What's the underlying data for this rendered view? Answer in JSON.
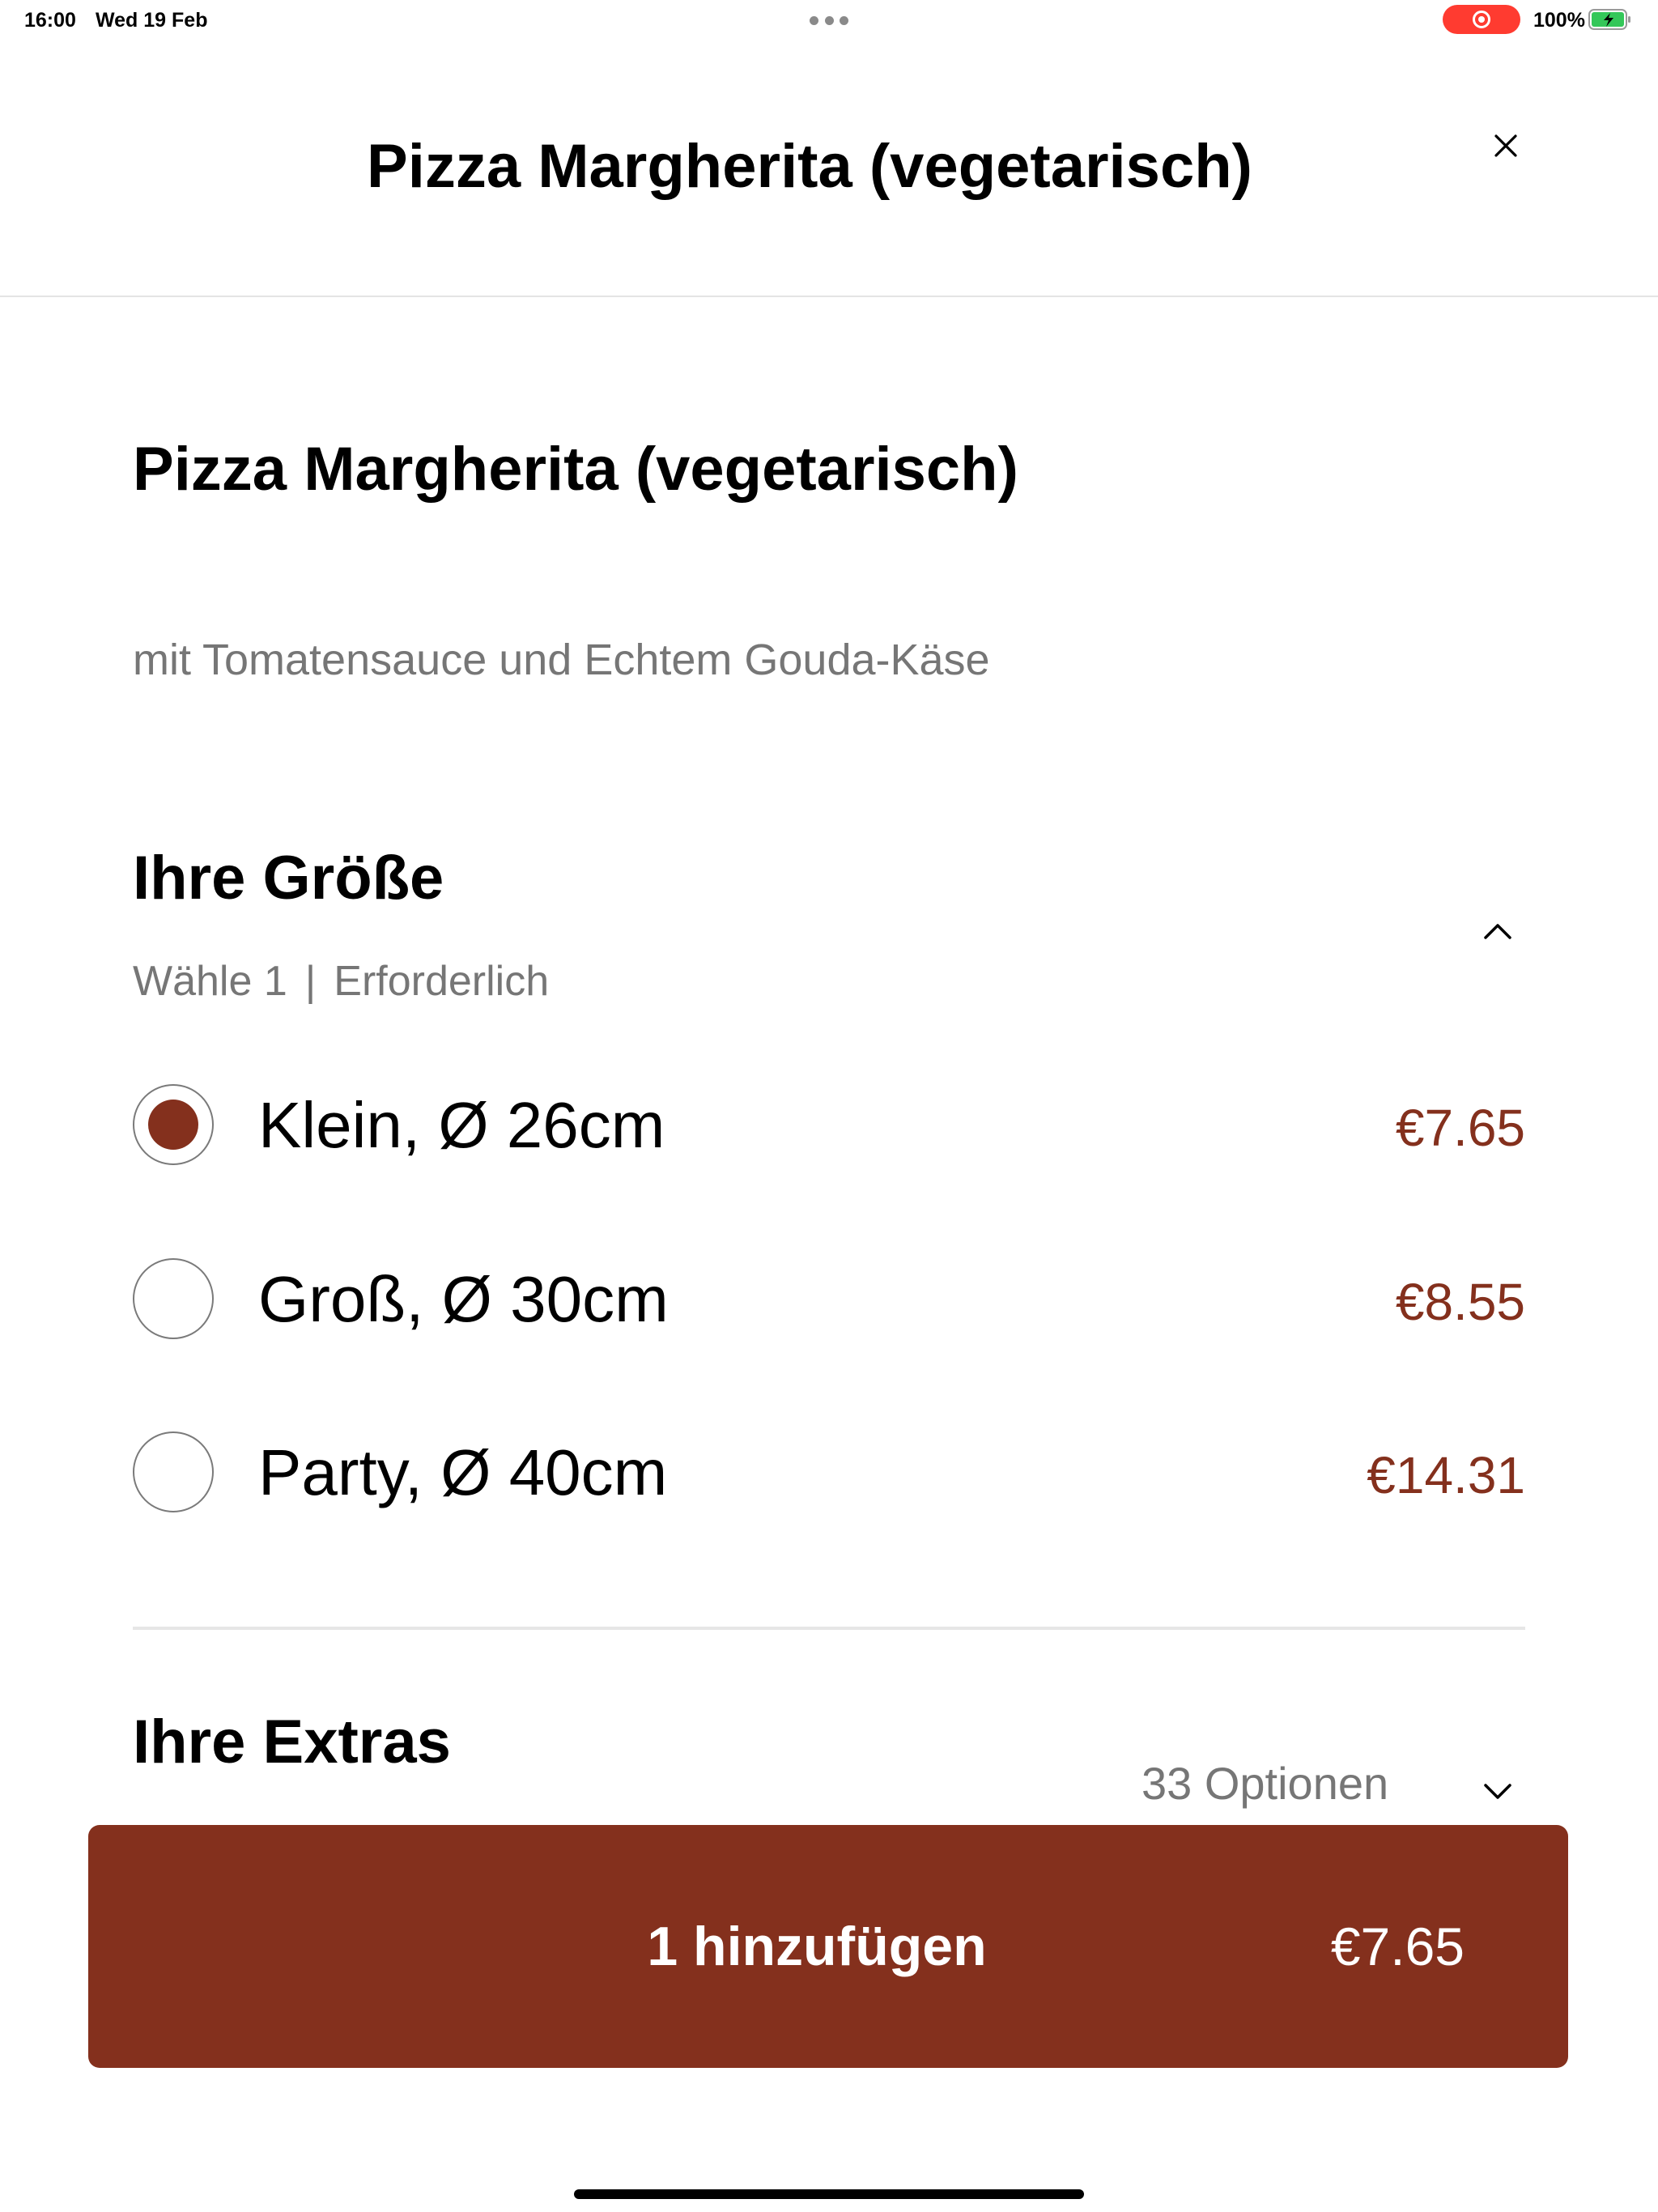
{
  "status_bar": {
    "time": "16:00",
    "date": "Wed 19 Feb",
    "battery": "100%"
  },
  "header": {
    "title": "Pizza Margherita (vegetarisch)",
    "close_icon": "close-icon"
  },
  "item": {
    "title": "Pizza Margherita (vegetarisch)",
    "description": "mit Tomatensauce und Echtem Gouda-Käse"
  },
  "size_section": {
    "title": "Ihre Größe",
    "choose": "Wähle 1",
    "separator": "|",
    "required": "Erforderlich",
    "expanded": true,
    "options": [
      {
        "label": "Klein, Ø 26cm",
        "price": "€7.65",
        "selected": true
      },
      {
        "label": "Groß, Ø 30cm",
        "price": "€8.55",
        "selected": false
      },
      {
        "label": "Party, Ø 40cm",
        "price": "€14.31",
        "selected": false
      }
    ]
  },
  "extras_section": {
    "title": "Ihre Extras",
    "count_label": "33 Optionen",
    "expanded": false
  },
  "add_button": {
    "label": "1 hinzufügen",
    "price": "€7.65"
  },
  "colors": {
    "accent": "#84301d",
    "muted_text": "#767676",
    "divider": "#e6e6e6",
    "recording": "#ff3b30",
    "battery_charging": "#34c759"
  }
}
